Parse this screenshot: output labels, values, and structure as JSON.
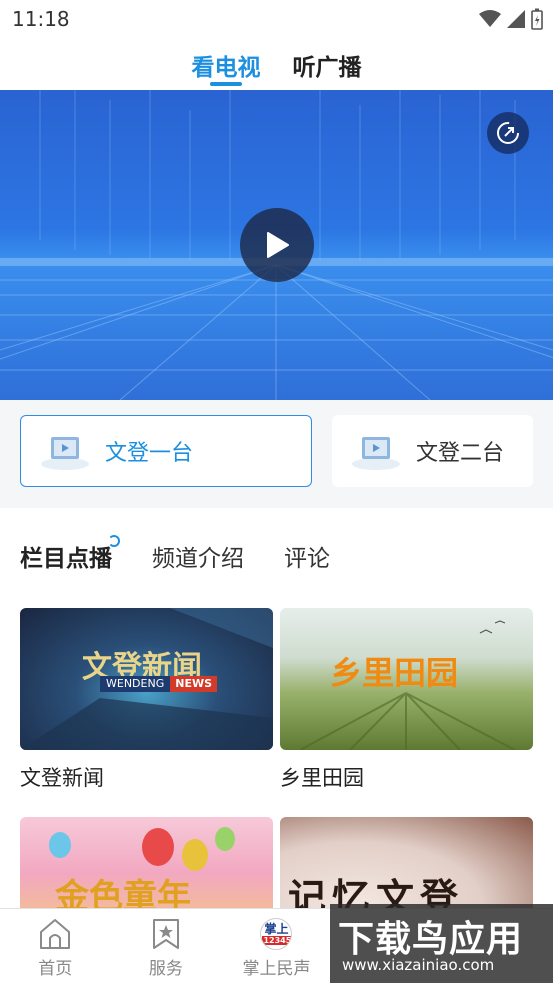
{
  "status_bar": {
    "time": "11:18"
  },
  "top_tabs": [
    {
      "label": "看电视",
      "active": true
    },
    {
      "label": "听广播",
      "active": false
    }
  ],
  "channels": [
    {
      "name": "文登一台",
      "active": true
    },
    {
      "name": "文登二台",
      "active": false
    }
  ],
  "sub_tabs": [
    {
      "label": "栏目点播",
      "active": true
    },
    {
      "label": "频道介绍",
      "active": false
    },
    {
      "label": "评论",
      "active": false
    }
  ],
  "programs": [
    {
      "title": "文登新闻",
      "thumb_text": "文登新闻",
      "thumb_sub": "WENDENG",
      "thumb_badge": "NEWS"
    },
    {
      "title": "乡里田园",
      "thumb_text": "乡里田园"
    },
    {
      "title": "",
      "thumb_text": "金色童年"
    },
    {
      "title": "",
      "thumb_text": "记忆文登"
    }
  ],
  "bottom_nav": [
    {
      "label": "首页",
      "icon": "home-icon"
    },
    {
      "label": "服务",
      "icon": "bookmark-star-icon"
    },
    {
      "label": "掌上民声",
      "icon": "hotline-logo-icon",
      "logo_text": "掌上",
      "logo_sub": "12345"
    },
    {
      "label": "",
      "icon": ""
    },
    {
      "label": "",
      "icon": ""
    }
  ],
  "watermark": {
    "text": "下载鸟应用",
    "url": "www.xiazainiao.com"
  },
  "colors": {
    "accent": "#1c8fe0",
    "video_bg": "#2c76e3",
    "strip_bg": "#f4f6f8"
  }
}
